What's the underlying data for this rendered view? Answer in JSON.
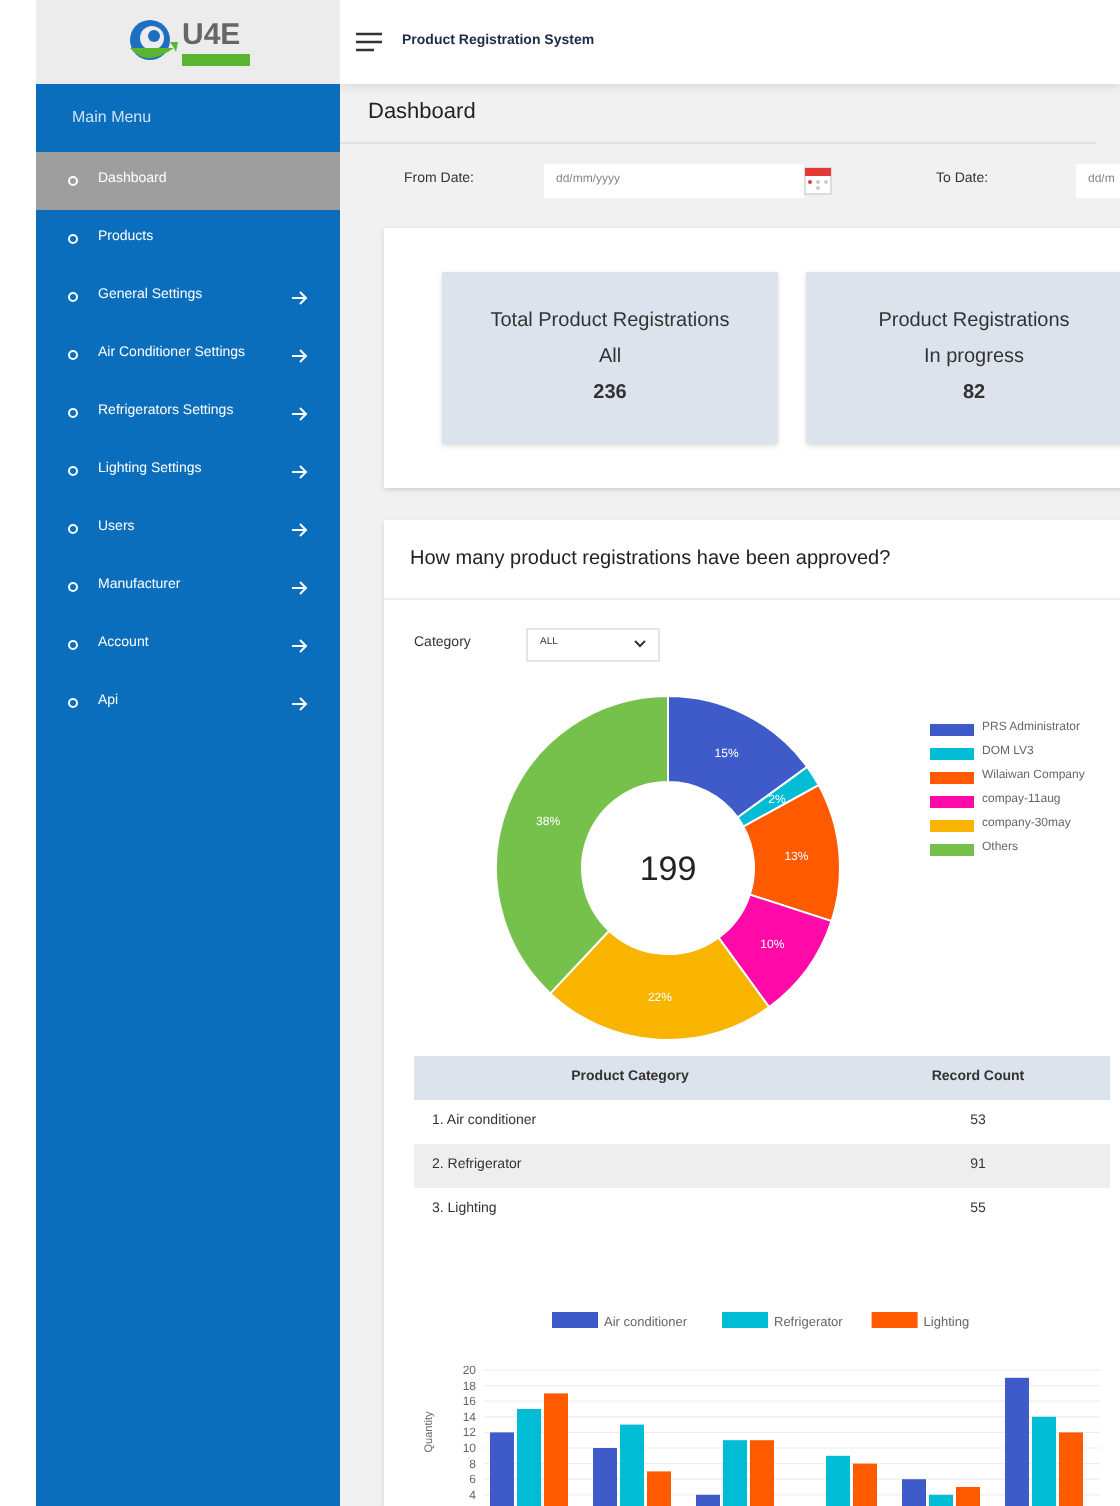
{
  "logo": {
    "text": "U4E"
  },
  "header": {
    "title": "Product Registration System"
  },
  "sidebar": {
    "heading": "Main Menu",
    "items": [
      {
        "label": "Dashboard",
        "selected": true,
        "has_arrow": false
      },
      {
        "label": "Products",
        "selected": false,
        "has_arrow": false
      },
      {
        "label": "General Settings",
        "selected": false,
        "has_arrow": true
      },
      {
        "label": "Air Conditioner Settings",
        "selected": false,
        "has_arrow": true
      },
      {
        "label": "Refrigerators Settings",
        "selected": false,
        "has_arrow": true
      },
      {
        "label": "Lighting Settings",
        "selected": false,
        "has_arrow": true
      },
      {
        "label": "Users",
        "selected": false,
        "has_arrow": true
      },
      {
        "label": "Manufacturer",
        "selected": false,
        "has_arrow": true
      },
      {
        "label": "Account",
        "selected": false,
        "has_arrow": true
      },
      {
        "label": "Api",
        "selected": false,
        "has_arrow": true
      }
    ]
  },
  "page_title": "Dashboard",
  "filters": [
    {
      "label": "From Date:",
      "placeholder": "dd/mm/yyyy",
      "calendar": true
    },
    {
      "label": "To Date:",
      "placeholder": "dd/m",
      "calendar": false
    }
  ],
  "stats": [
    {
      "title": "Total Product Registrations",
      "subtitle": "All",
      "value": "236"
    },
    {
      "title": "Product Registrations",
      "subtitle": "In progress",
      "value": "82"
    }
  ],
  "approved": {
    "title": "How many product registrations have been approved?",
    "category_label": "Category",
    "category_value": "ALL",
    "center_total": "199",
    "chart_data": {
      "type": "donut",
      "categories": [
        "PRS Administrator",
        "DOM LV3",
        "Wilaiwan Company",
        "compay-11aug",
        "company-30may",
        "Others"
      ],
      "legend": true,
      "series": [
        {
          "colors": [
            "#3f5bc9",
            "#00bcd4",
            "#ff5a00",
            "#ff0aa8",
            "#f9b400",
            "#76c14c"
          ],
          "values": [
            15,
            2,
            13,
            10,
            22,
            38
          ]
        }
      ],
      "value_labels": [
        "15%",
        "2%",
        "13%",
        "10%",
        "22%",
        "38%"
      ]
    },
    "table": {
      "columns": [
        "Product Category",
        "Record Count"
      ],
      "rows": [
        [
          "1. Air conditioner",
          "53"
        ],
        [
          "2. Refrigerator",
          "91"
        ],
        [
          "3. Lighting",
          "55"
        ]
      ]
    }
  },
  "quantity_chart": {
    "chart_data": {
      "type": "bar",
      "ylabel": "Quantity",
      "ylim": [
        0,
        20
      ],
      "grid": true,
      "legend": true,
      "yticks": [
        4,
        6,
        8,
        10,
        12,
        14,
        16,
        18,
        20
      ],
      "series": [
        {
          "name": "Air conditioner",
          "color": "#3f5bc9",
          "values": [
            12,
            10,
            4,
            null,
            6,
            19
          ]
        },
        {
          "name": "Refrigerator",
          "color": "#00bcd4",
          "values": [
            15,
            13,
            11,
            9,
            4,
            14
          ]
        },
        {
          "name": "Lighting",
          "color": "#ff5a00",
          "values": [
            17,
            7,
            11,
            8,
            5,
            12
          ]
        }
      ]
    }
  }
}
